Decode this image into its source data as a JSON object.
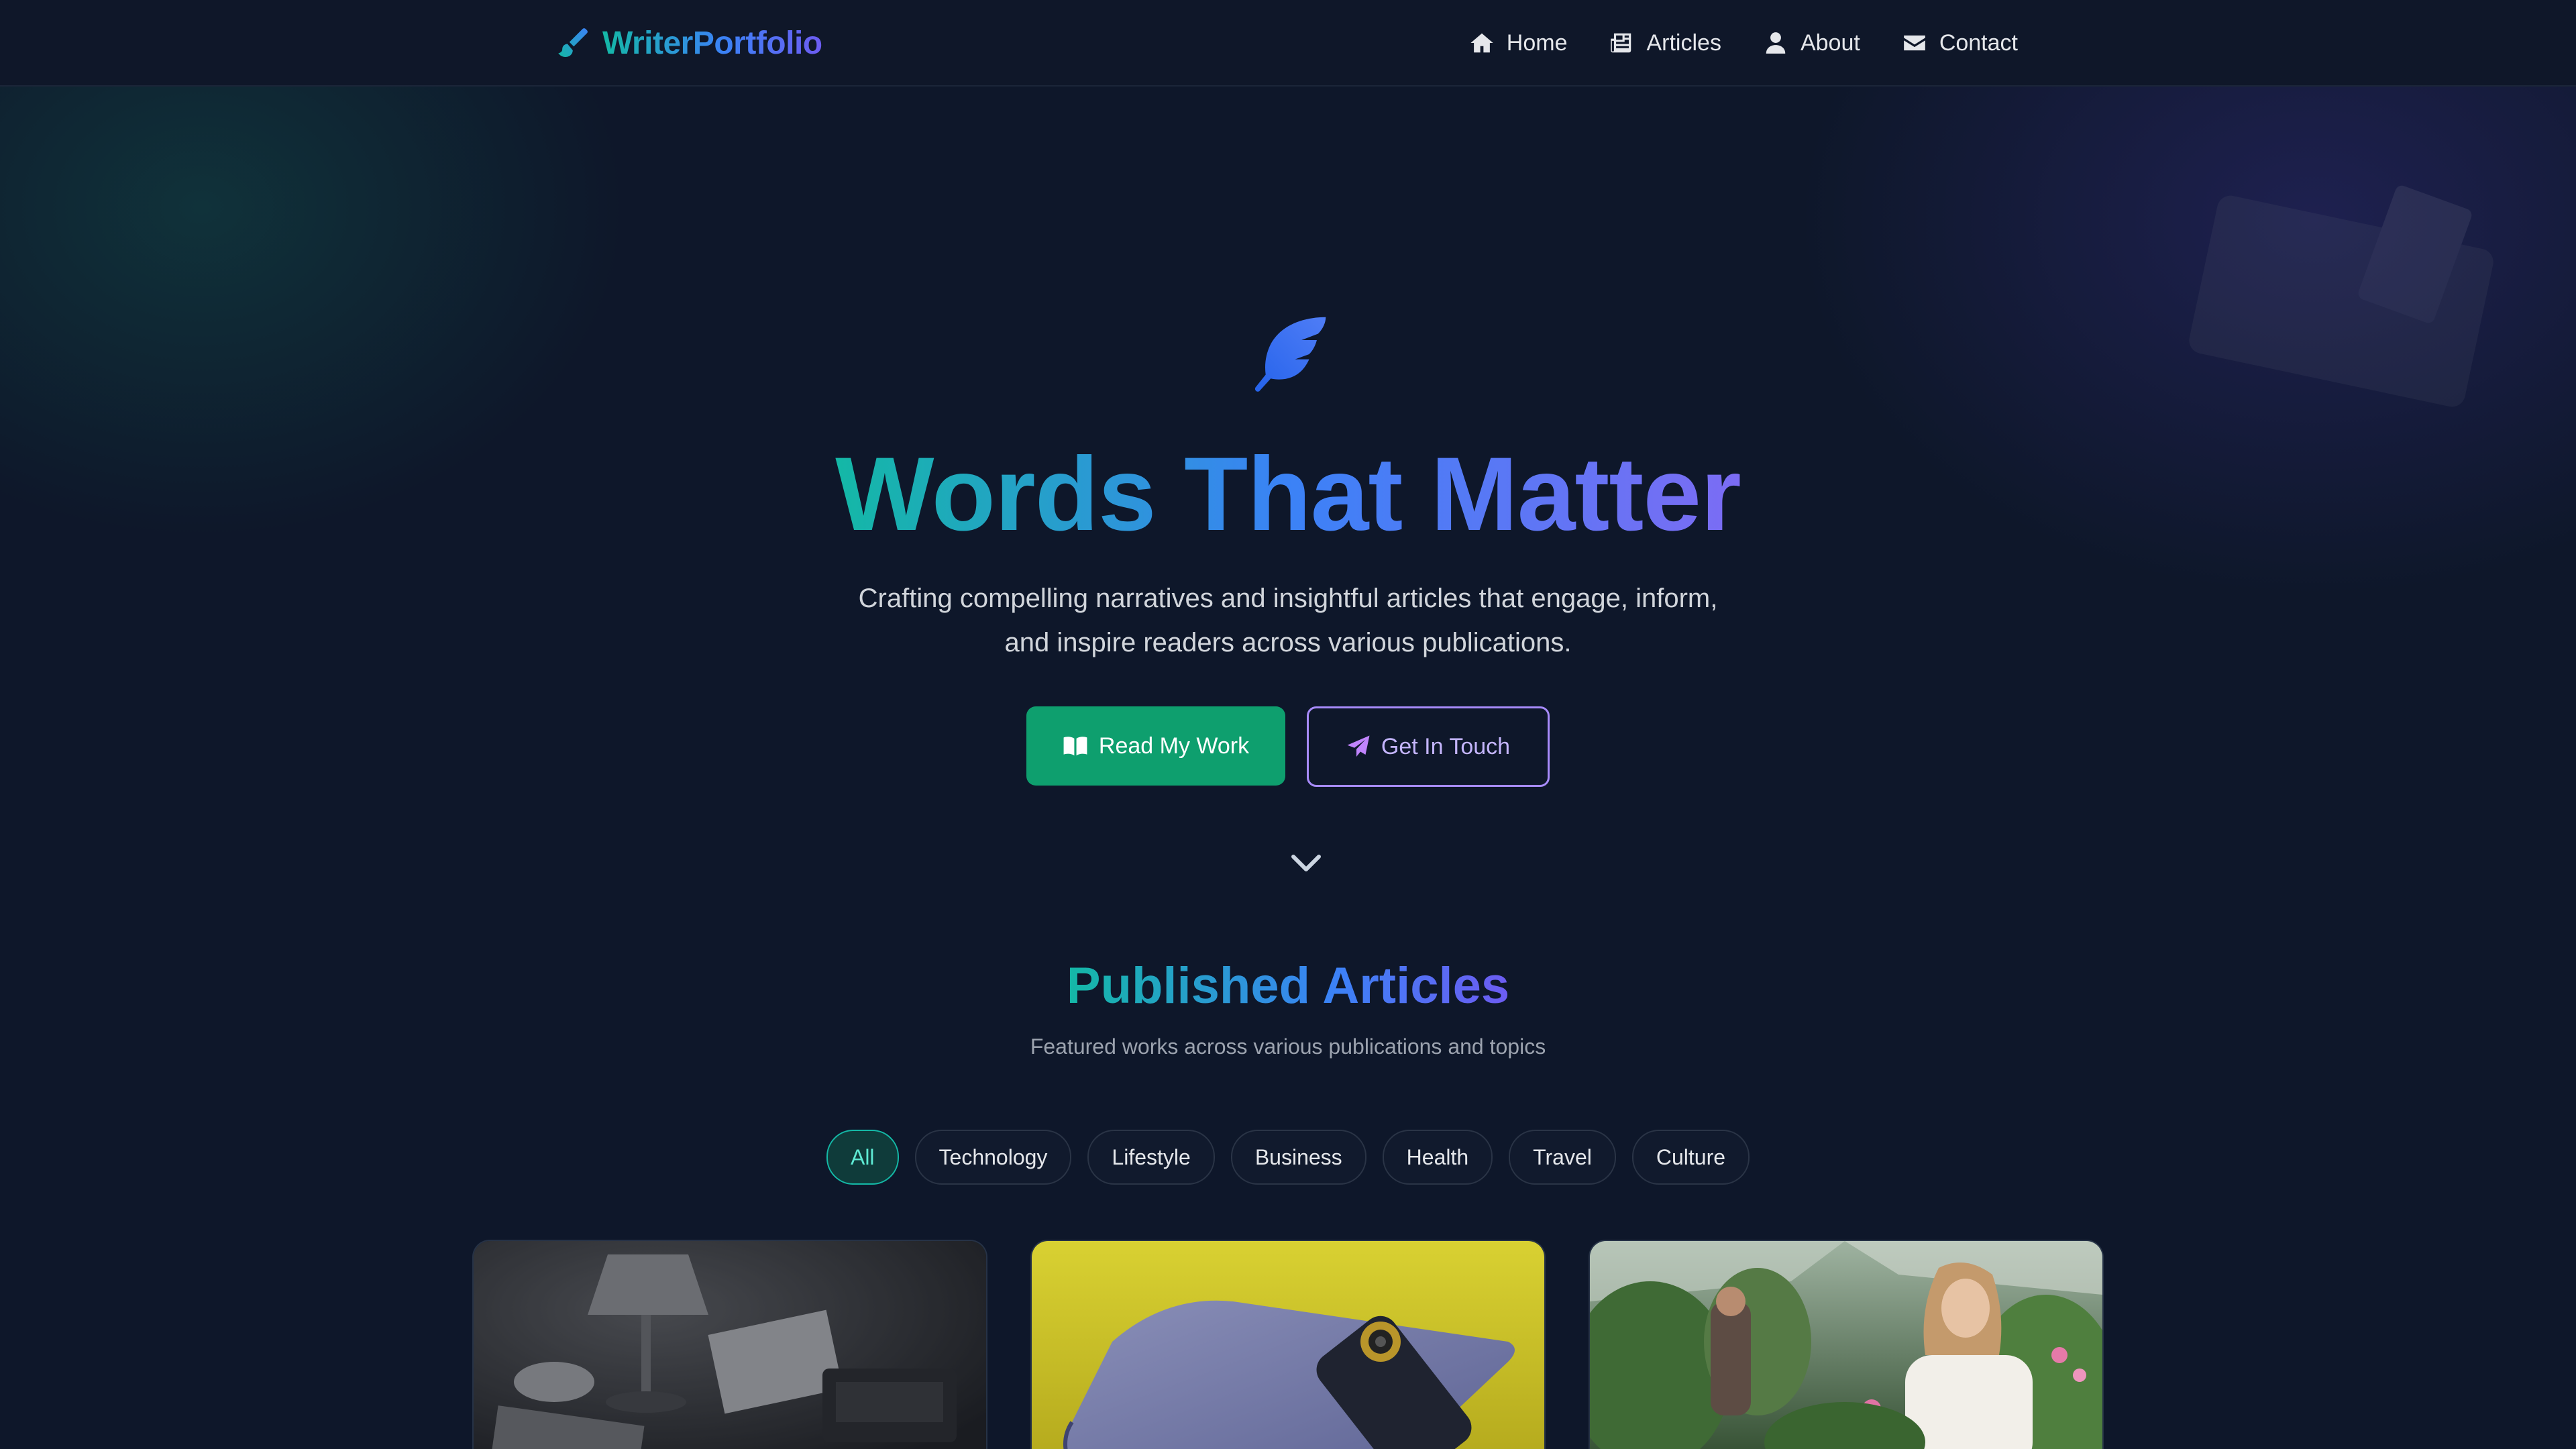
{
  "brand": {
    "name": "WriterPortfolio",
    "icon": "paintbrush-icon"
  },
  "nav": {
    "items": [
      {
        "label": "Home",
        "icon": "home-icon"
      },
      {
        "label": "Articles",
        "icon": "newspaper-icon"
      },
      {
        "label": "About",
        "icon": "user-icon"
      },
      {
        "label": "Contact",
        "icon": "envelope-icon"
      }
    ]
  },
  "hero": {
    "icon": "feather-icon",
    "title": "Words That Matter",
    "subtitle_line1": "Crafting compelling narratives and insightful articles that engage, inform,",
    "subtitle_line2": "and inspire readers across various publications.",
    "primary_button": {
      "label": "Read My Work",
      "icon": "book-open-icon"
    },
    "secondary_button": {
      "label": "Get In Touch",
      "icon": "paper-plane-icon"
    },
    "scroll_icon": "chevron-down-icon"
  },
  "articles": {
    "title": "Published Articles",
    "subtitle": "Featured works across various publications and topics",
    "filters": [
      "All",
      "Technology",
      "Lifestyle",
      "Business",
      "Health",
      "Travel",
      "Culture"
    ],
    "active_filter": "All"
  },
  "colors": {
    "background": "#0e172a",
    "accent_green": "#0e9f6e",
    "accent_teal": "#14b8a6",
    "accent_blue": "#3b82f6",
    "accent_purple": "#a78bfa"
  }
}
